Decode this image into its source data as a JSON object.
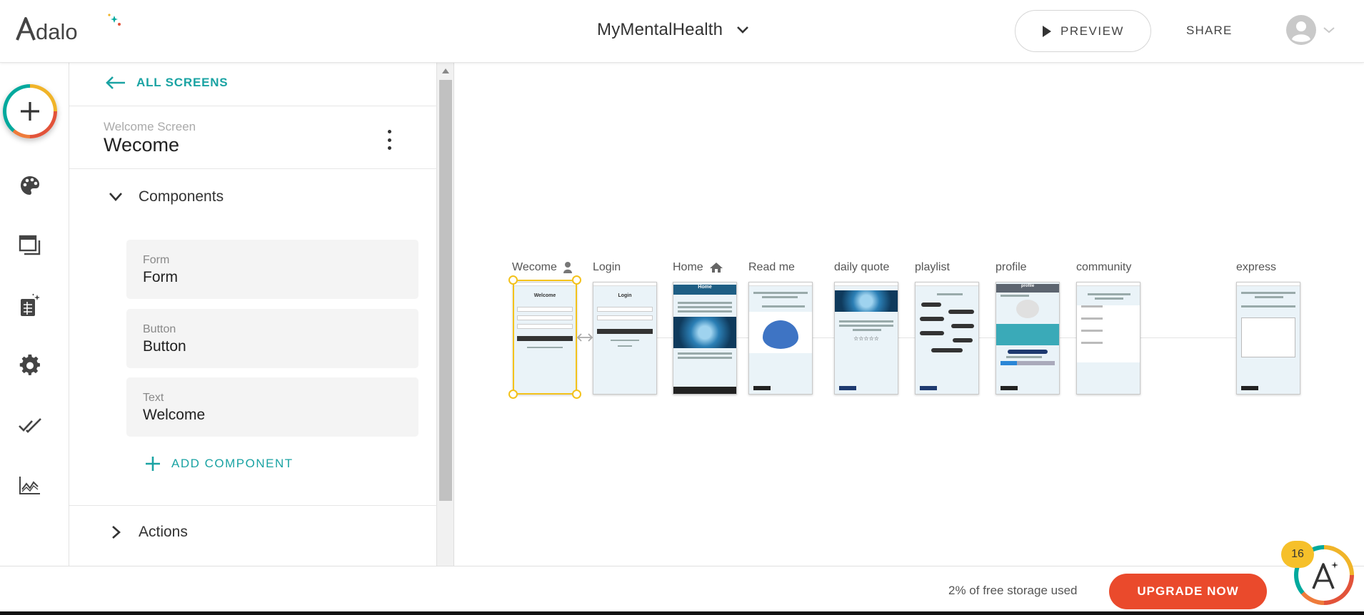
{
  "header": {
    "logo_text": "Adalo",
    "app_name": "MyMentalHealth",
    "preview_label": "PREVIEW",
    "share_label": "SHARE"
  },
  "rail": {
    "icons": [
      "add-icon",
      "palette-icon",
      "screens-icon",
      "database-icon",
      "settings-icon",
      "publish-check-icon",
      "analytics-icon"
    ]
  },
  "panel": {
    "back_label": "ALL SCREENS",
    "screen_type": "Welcome Screen",
    "screen_name": "Wecome",
    "components_label": "Components",
    "components": [
      {
        "type": "Form",
        "name": "Form"
      },
      {
        "type": "Button",
        "name": "Button"
      },
      {
        "type": "Text",
        "name": "Welcome"
      }
    ],
    "add_component_label": "ADD COMPONENT",
    "actions_label": "Actions"
  },
  "canvas": {
    "screens": [
      {
        "label": "Wecome",
        "title": "Welcome"
      },
      {
        "label": "Login",
        "title": "Login"
      },
      {
        "label": "Home",
        "title": "Home"
      },
      {
        "label": "Read me",
        "title": ""
      },
      {
        "label": "daily quote",
        "title": ""
      },
      {
        "label": "playlist",
        "title": ""
      },
      {
        "label": "profile",
        "title": "profile"
      },
      {
        "label": "community",
        "title": ""
      },
      {
        "label": "express",
        "title": ""
      }
    ]
  },
  "footer": {
    "storage_text": "2% of free storage used",
    "upgrade_label": "UPGRADE NOW",
    "help_badge": "16"
  },
  "colors": {
    "accent": "#1aa3a3",
    "upgrade": "#ea4a2c",
    "selection": "#f3c21b",
    "badge": "#f6c02a"
  }
}
